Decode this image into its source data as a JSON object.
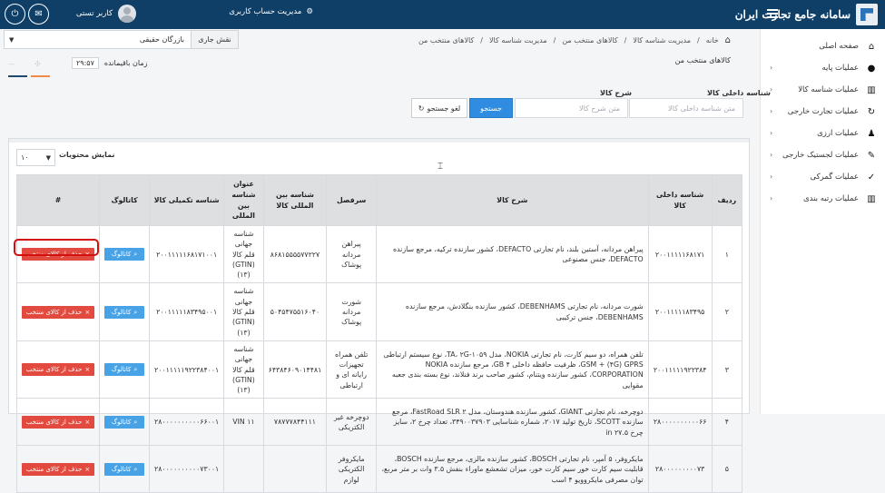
{
  "topbar": {
    "brand": "سامانه جامع تجارت ایران",
    "account_link": "مدیریت حساب کاربری",
    "user_name": "کاربر تستی"
  },
  "breadcrumb": [
    "خانه",
    "مدیریت شناسه کالا",
    "کالاهای منتخب من",
    "مدیریت شناسه کالا",
    "کالاهای منتخب من"
  ],
  "role": {
    "label": "نقش جاری",
    "value": "بازرگان حقیقی"
  },
  "page": {
    "title": "کالاهای منتخب من",
    "session_label": "زمان باقیمانده",
    "session_time": "۲۹:۵۷"
  },
  "sidebar": {
    "items": [
      {
        "label": "صفحه اصلی",
        "icon": "home-icon"
      },
      {
        "label": "عملیات پایه",
        "icon": "person-icon"
      },
      {
        "label": "عملیات شناسه کالا",
        "icon": "barcode-icon"
      },
      {
        "label": "عملیات تجارت خارجی",
        "icon": "refresh-icon"
      },
      {
        "label": "عملیات ارزی",
        "icon": "users-icon"
      },
      {
        "label": "عملیات لجستیک خارجی",
        "icon": "edit-icon"
      },
      {
        "label": "عملیات گمرکی",
        "icon": "check-icon"
      },
      {
        "label": "عملیات رتبه بندی",
        "icon": "barcode-icon"
      }
    ]
  },
  "search": {
    "field1_label": "شناسه داخلی کالا",
    "field1_placeholder": "متن شناسه داخلی کالا",
    "field2_label": "شرح کالا",
    "field2_placeholder": "متن شرح کالا",
    "search_button": "جستجو",
    "cancel_button": "لغو جستجو"
  },
  "table": {
    "show_label": "نمایش محتویات",
    "page_size": "۱۰",
    "headers": [
      "ردیف",
      "شناسه داخلی کالا",
      "شرح کالا",
      "سرفصل",
      "شناسه بین المللی کالا",
      "عنوان شناسه بین المللی",
      "شناسه تکمیلی کالا",
      "کاتالوگ",
      "#"
    ],
    "catalog_button": "کاتالوگ",
    "remove_button": "حذف از کالای منتخب",
    "rows": [
      {
        "index": "۱",
        "internal_id": "۲۰۰۱۱۱۱۱۶۸۱۷۱",
        "description": "پیراهن مردانه، آستین بلند، نام تجارتی DEFACTO، کشور سازنده ترکیه، مرجع سازنده DEFACTO، جنس مصنوعی",
        "category": "پیراهن مردانه پوشاک",
        "global_id": "۸۶۸۱۵۵۵۵۷۷۲۲۷",
        "global_title": "شناسه جهانی قلم کالا (GTIN) (۱۳)",
        "extra_id": "۲۰۰۱۱۱۱۱۶۸۱۷۱۰۰۱"
      },
      {
        "index": "۲",
        "internal_id": "۲۰۰۱۱۱۱۱۸۳۴۹۵",
        "description": "شورت مردانه، نام تجارتی DEBENHAMS، کشور سازنده بنگلادش، مرجع سازنده DEBENHAMS، جنس ترکیبی",
        "category": "شورت مردانه پوشاک",
        "global_id": "۵۰۴۵۴۷۵۵۱۶۰۴۰",
        "global_title": "شناسه جهانی قلم کالا (GTIN) (۱۳)",
        "extra_id": "۲۰۰۱۱۱۱۱۸۳۴۹۵۰۰۱"
      },
      {
        "index": "۳",
        "internal_id": "۲۰۰۱۱۱۱۱۹۲۲۳۸۴",
        "description": "تلفن همراه، دو سیم کارت، نام تجارتی NOKIA، مدل ۱۰۵۹-TA، ۲G، نوع سیستم ارتباطی GSM + (۴G) GPRS، ظرفیت حافظه داخلی ۴ GB، مرجع سازنده NOKIA CORPORATION، کشور سازنده ویتنام، کشور صاحب برند فنلاند، نوع بسته بندی جعبه مقوایی",
        "category": "تلفن همراه تجهیزات رایانه ای و ارتباطی",
        "global_id": "۶۴۳۸۴۶۰۹۰۱۴۴۸۱",
        "global_title": "شناسه جهانی قلم کالا (GTIN) (۱۳)",
        "extra_id": "۲۰۰۱۱۱۱۱۹۲۲۳۸۴۰۰۱"
      },
      {
        "index": "۴",
        "internal_id": "۲۸۰۰۰۰۰۰۰۰۰۰۶۶",
        "description": "دوچرخه، نام تجارتی GIANT، کشور سازنده هندوستان، مدل FastRoad SLR ۲، مرجع سازنده SCOTT، تاریخ تولید ۲۰۱۷، شماره شناسایی ۳۴۹۰۰۳۷۹۰۳، تعداد چرخ ۲، سایز چرخ ۲۷.۵ in",
        "category": "دوچرخه غیر الکتریکی",
        "global_id": "۷۸۷۷۷۸۴۴۱۱۱",
        "global_title": "VIN ۱۱",
        "extra_id": "۲۸۰۰۰۰۰۰۰۰۰۰۶۶۰۰۱"
      },
      {
        "index": "۵",
        "internal_id": "۲۸۰۰۰۰۰۰۰۰۰۷۳",
        "description": "مایکروفر، ۵ آمپر، نام تجارتی BOSCH، کشور سازنده مالزی، مرجع سازنده BOSCH، قابلیت سیم کارت خور سیم کارت خور، میزان تشعشع ماوراء بنفش ۳.۵ وات بر متر مربع، توان مصرفی مایکروویو ۴ اسب",
        "category": "مایکروفر الکتریکی لوازم",
        "global_id": "",
        "global_title": "",
        "extra_id": "۲۸۰۰۰۰۰۰۰۰۰۰۷۳۰۰۱"
      }
    ]
  },
  "colors": {
    "topbar": "#0f3e67",
    "primary": "#2f8ce0",
    "catalog": "#48a3e6",
    "danger": "#e24a3f"
  }
}
